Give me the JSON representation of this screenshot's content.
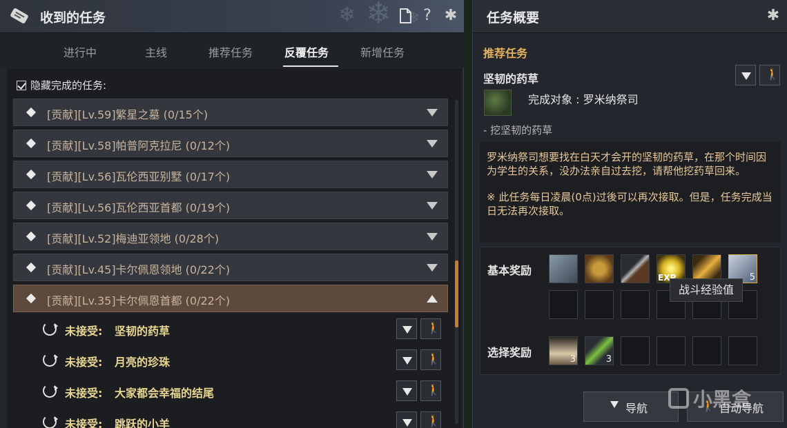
{
  "left_window": {
    "title": "收到的任务",
    "doc_icon": "document-icon",
    "help_label": "?",
    "tabs": [
      {
        "label": "进行中"
      },
      {
        "label": "主线"
      },
      {
        "label": "推荐任务"
      },
      {
        "label": "反覆任务",
        "active": true
      },
      {
        "label": "新增任务"
      }
    ],
    "hide_completed_label": "隐藏完成的任务:",
    "hide_completed_checked": true,
    "quest_groups": [
      {
        "label": "[贡献][Lv.59]繁星之墓 (0/15个)"
      },
      {
        "label": "[贡献][Lv.58]帕普阿克拉尼 (0/12个)"
      },
      {
        "label": "[贡献][Lv.56]瓦伦西亚别墅 (0/17个)"
      },
      {
        "label": "[贡献][Lv.56]瓦伦西亚首都 (0/19个)"
      },
      {
        "label": "[贡献][Lv.52]梅迪亚领地 (0/28个)"
      },
      {
        "label": "[贡献][Lv.45]卡尔佩恩领地 (0/22个)"
      },
      {
        "label": "[贡献][Lv.35]卡尔佩恩首都 (0/22个)",
        "expanded": true
      }
    ],
    "sub_quests": [
      {
        "status": "未接受:",
        "name": "坚韧的药草"
      },
      {
        "status": "未接受:",
        "name": "月亮的珍珠"
      },
      {
        "status": "未接受:",
        "name": "大家都会幸福的结尾"
      },
      {
        "status": "未接受:",
        "name": "跳跃的小羊"
      }
    ]
  },
  "right_window": {
    "title": "任务概要",
    "section": "推荐任务",
    "quest_name": "坚韧的药草",
    "target_label": "完成对象 : 罗米纳祭司",
    "objective": "- 挖坚韧的药草",
    "description": "罗米纳祭司想要找在白天才会开的坚韧的药草，在那个时间因为学生的关系，没办法亲自过去挖，请帮他挖药草回来。",
    "note": "※ 此任务每日凌晨(0点)过後可以再次接取。但是，任务完成当日无法再次接取。",
    "basic_reward_label": "基本奖励",
    "select_reward_label": "选择奖励",
    "basic_rewards": [
      {
        "icon": "scroll-item-icon",
        "count": ""
      },
      {
        "icon": "medal-icon",
        "count": ""
      },
      {
        "icon": "dagger-icon",
        "count": ""
      },
      {
        "icon": "exp-orb-icon",
        "count": "",
        "tag": "EXP"
      },
      {
        "icon": "golden-scroll-icon",
        "count": ""
      },
      {
        "icon": "contribution-icon",
        "count": "5"
      }
    ],
    "select_rewards": [
      {
        "icon": "milk-bottle-icon",
        "count": "3"
      },
      {
        "icon": "green-potion-icon",
        "count": "3"
      }
    ],
    "tooltip": "战斗经验值",
    "nav_button": "导航",
    "auto_nav_button": "自动导航",
    "watermark": "小黑盒"
  },
  "colors": {
    "accent_orange": "#c87a2e",
    "quest_status_yellow": "#e8d690",
    "section_gold": "#e6b45c"
  }
}
